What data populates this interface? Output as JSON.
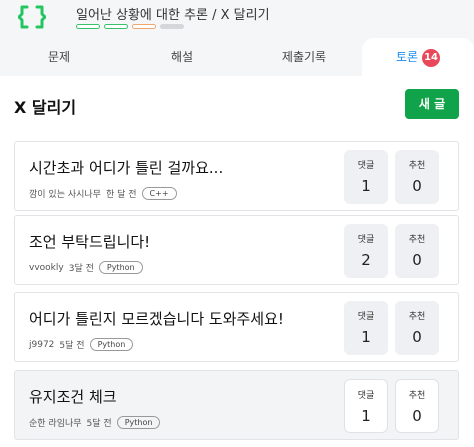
{
  "problem": {
    "title": "일어난 상황에 대한 추론 / X 달리기",
    "colors": {
      "level_green": "#3ac06a",
      "level_orange": "#f0a56b",
      "level_gray": "#d5d7db"
    }
  },
  "tabs": [
    {
      "label": "문제"
    },
    {
      "label": "해설"
    },
    {
      "label": "제출기록"
    },
    {
      "label": "토론",
      "badge": "14",
      "active": true
    }
  ],
  "page": {
    "heading": "X 달리기",
    "new_post_label": "새 글"
  },
  "stat_labels": {
    "comments": "댓글",
    "likes": "추천"
  },
  "posts": [
    {
      "title": "시간초과 어디가 틀린 걸까요...",
      "author": "깜이 있는 사시나무",
      "time": "한 달 전",
      "language": "C++",
      "comments": "1",
      "likes": "0"
    },
    {
      "title": "조언 부탁드립니다!",
      "author": "vvookly",
      "time": "3달 전",
      "language": "Python",
      "comments": "2",
      "likes": "0"
    },
    {
      "title": "어디가 틀린지 모르겠습니다 도와주세요!",
      "author": "j9972",
      "time": "5달 전",
      "language": "Python",
      "comments": "1",
      "likes": "0"
    },
    {
      "title": "유지조건 체크",
      "author": "순한 라임나무",
      "time": "5달 전",
      "language": "Python",
      "comments": "1",
      "likes": "0"
    }
  ],
  "colors": {
    "accent_blue": "#1e8cf0",
    "button_green": "#10a34a",
    "badge_red": "#e9485b"
  }
}
